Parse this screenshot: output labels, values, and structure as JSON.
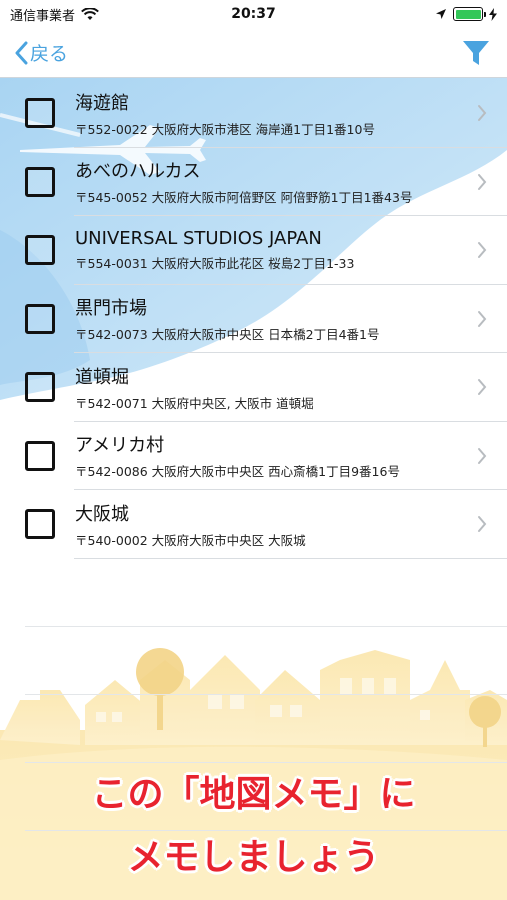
{
  "status_bar": {
    "carrier": "通信事業者",
    "time": "20:37"
  },
  "nav": {
    "back_label": "戻る",
    "filter_icon": "filter-icon"
  },
  "places": [
    {
      "name": "海遊館",
      "address": "〒552-0022 大阪府大阪市港区 海岸通1丁目1番10号"
    },
    {
      "name": "あべのハルカス",
      "address": "〒545-0052 大阪府大阪市阿倍野区 阿倍野筋1丁目1番43号"
    },
    {
      "name": "UNIVERSAL STUDIOS JAPAN",
      "address": "〒554-0031 大阪府大阪市此花区 桜島2丁目1-33"
    },
    {
      "name": "黒門市場",
      "address": "〒542-0073 大阪府大阪市中央区 日本橋2丁目4番1号"
    },
    {
      "name": "道頓堀",
      "address": "〒542-0071 大阪府中央区, 大阪市 道頓堀"
    },
    {
      "name": "アメリカ村",
      "address": "〒542-0086 大阪府大阪市中央区 西心斎橋1丁目9番16号"
    },
    {
      "name": "大阪城",
      "address": "〒540-0002 大阪府大阪市中央区 大阪城"
    }
  ],
  "promo": {
    "line1": "この「地図メモ」に",
    "line2": "メモしましょう"
  },
  "colors": {
    "accent": "#4aa3df",
    "promo_text": "#e8232f",
    "sky": "#a9d4f2",
    "town": "#f6dc96"
  }
}
